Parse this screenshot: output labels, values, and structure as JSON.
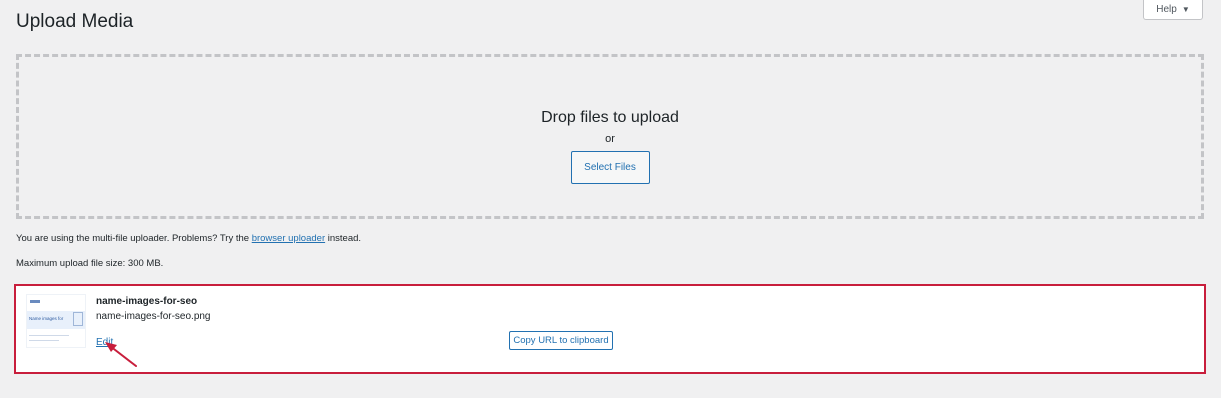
{
  "page": {
    "title": "Upload Media"
  },
  "help": {
    "label": "Help",
    "caret": "▼"
  },
  "dropzone": {
    "title": "Drop files to upload",
    "or": "or",
    "select_button": "Select Files"
  },
  "uploader_note": {
    "prefix": "You are using the multi-file uploader. Problems? Try the ",
    "link": "browser uploader",
    "suffix": " instead."
  },
  "max_size": "Maximum upload file size: 300 MB.",
  "media_item": {
    "title": "name-images-for-seo",
    "filename": "name-images-for-seo.png",
    "edit_label": "Edit",
    "copy_button": "Copy URL to clipboard",
    "thumb_caption": "Name images for"
  },
  "colors": {
    "highlight_border": "#c81e3c",
    "accent": "#2271b1",
    "background": "#f0f0f1"
  }
}
